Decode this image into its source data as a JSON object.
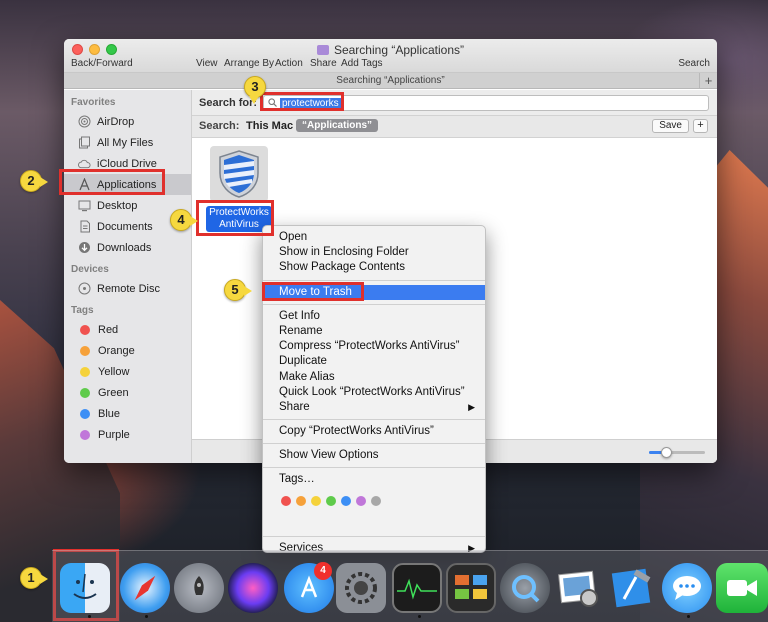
{
  "finder": {
    "title": "Searching “Applications”",
    "toolbar": {
      "back_forward": "Back/Forward",
      "view": "View",
      "arrange_by": "Arrange By",
      "action": "Action",
      "share": "Share",
      "add_tags": "Add Tags",
      "search": "Search"
    },
    "tab_title": "Searching “Applications”",
    "tab_plus": "+",
    "sidebar": {
      "favorites_header": "Favorites",
      "favorites": [
        {
          "label": "AirDrop",
          "icon": "airdrop-icon"
        },
        {
          "label": "All My Files",
          "icon": "all-files-icon"
        },
        {
          "label": "iCloud Drive",
          "icon": "cloud-icon"
        },
        {
          "label": "Applications",
          "icon": "applications-icon"
        },
        {
          "label": "Desktop",
          "icon": "desktop-icon"
        },
        {
          "label": "Documents",
          "icon": "documents-icon"
        },
        {
          "label": "Downloads",
          "icon": "downloads-icon"
        }
      ],
      "devices_header": "Devices",
      "devices": [
        {
          "label": "Remote Disc",
          "icon": "disc-icon"
        }
      ],
      "tags_header": "Tags",
      "tags": [
        {
          "label": "Red",
          "color": "#f0524f"
        },
        {
          "label": "Orange",
          "color": "#f6a13a"
        },
        {
          "label": "Yellow",
          "color": "#f5d23b"
        },
        {
          "label": "Green",
          "color": "#5fcb4b"
        },
        {
          "label": "Blue",
          "color": "#3d8ff5"
        },
        {
          "label": "Purple",
          "color": "#c077d9"
        }
      ]
    },
    "search": {
      "label": "Search for:",
      "value": "protectworks"
    },
    "scope": {
      "label": "Search:",
      "this_mac": "This Mac",
      "applications": "“Applications”",
      "save": "Save",
      "plus": "+"
    },
    "result": {
      "name_line1": "ProtectWorks",
      "name_line2": "AntiVirus"
    },
    "icon_size_slider": 0.3
  },
  "context_menu": {
    "group1": [
      "Open",
      "Show in Enclosing Folder",
      "Show Package Contents"
    ],
    "highlighted": "Move to Trash",
    "group2": [
      "Get Info",
      "Rename",
      "Compress “ProtectWorks AntiVirus”",
      "Duplicate",
      "Make Alias",
      "Quick Look “ProtectWorks AntiVirus”"
    ],
    "share": "Share",
    "copy": "Copy “ProtectWorks AntiVirus”",
    "view_options": "Show View Options",
    "tags_label": "Tags…",
    "tag_colors": [
      "#f0524f",
      "#f6a13a",
      "#f5d23b",
      "#5fcb4b",
      "#3d8ff5",
      "#c077d9",
      "#a8a8a8"
    ],
    "services": "Services"
  },
  "steps": [
    "1",
    "2",
    "3",
    "4",
    "5"
  ],
  "dock": {
    "apps": [
      "finder-icon",
      "safari-icon",
      "launchpad-icon",
      "siri-icon",
      "app-store-icon",
      "system-preferences-icon",
      "activity-monitor-icon",
      "mission-control-icon",
      "quicktime-icon",
      "preview-icon",
      "xcode-icon",
      "messages-icon",
      "facetime-icon"
    ],
    "app_store_badge": "4"
  },
  "colors": {
    "highlight": "#3b7cf0",
    "annotation_box": "#e0302c",
    "callout": "#f6d83f"
  }
}
